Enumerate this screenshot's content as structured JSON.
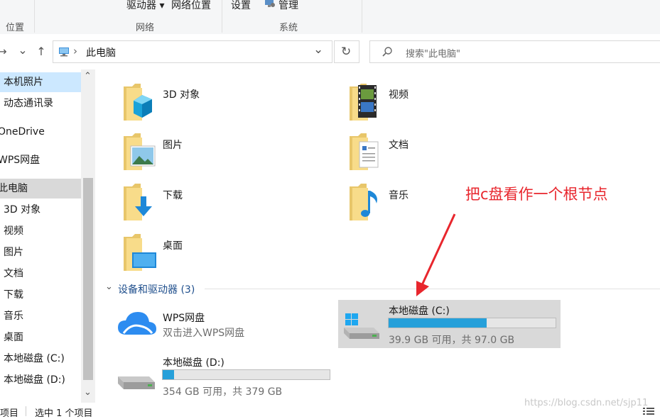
{
  "ribbon": {
    "drive_button": "驱动器 ▾",
    "network_location": "网络位置",
    "settings": "设置",
    "manage": "管理",
    "group_location": "位置",
    "group_network": "网络",
    "group_system": "系统"
  },
  "nav": {
    "forward": "→",
    "history": "⌄",
    "up": "↑",
    "breadcrumb_sep": "›",
    "path": "此电脑",
    "dropdown": "⌄",
    "refresh": "↻",
    "search_placeholder": "搜索\"此电脑\""
  },
  "sidebar": {
    "items": [
      {
        "label": "本机照片"
      },
      {
        "label": "动态通讯录"
      },
      {
        "label": "OneDrive"
      },
      {
        "label": "WPS网盘"
      },
      {
        "label": "此电脑"
      },
      {
        "label": "3D 对象"
      },
      {
        "label": "视频"
      },
      {
        "label": "图片"
      },
      {
        "label": "文档"
      },
      {
        "label": "下载"
      },
      {
        "label": "音乐"
      },
      {
        "label": "桌面"
      },
      {
        "label": "本地磁盘 (C:)"
      },
      {
        "label": "本地磁盘 (D:)"
      }
    ],
    "scroll_up": "⌃",
    "scroll_down": "⌄"
  },
  "folders": [
    {
      "label": "3D 对象"
    },
    {
      "label": "视频"
    },
    {
      "label": "图片"
    },
    {
      "label": "文档"
    },
    {
      "label": "下载"
    },
    {
      "label": "音乐"
    },
    {
      "label": "桌面"
    }
  ],
  "devices": {
    "header": "设备和驱动器 (3)",
    "header_chevron": "⌄",
    "items": [
      {
        "name": "WPS网盘",
        "sub": "双击进入WPS网盘"
      },
      {
        "name": "本地磁盘 (C:)",
        "sub": "39.9 GB 可用，共 97.0 GB",
        "used_fraction": 0.589
      },
      {
        "name": "本地磁盘 (D:)",
        "sub": "354 GB 可用，共 379 GB",
        "used_fraction": 0.066
      }
    ]
  },
  "annotation": "把c盘看作一个根节点",
  "status": {
    "items_tail": "项目",
    "selected": "选中 1 个项目"
  },
  "watermark": "https://blog.csdn.net/sjp11",
  "colors": {
    "accent": "#26a0da",
    "annotation": "#e8262d",
    "selection": "#cce8ff"
  }
}
